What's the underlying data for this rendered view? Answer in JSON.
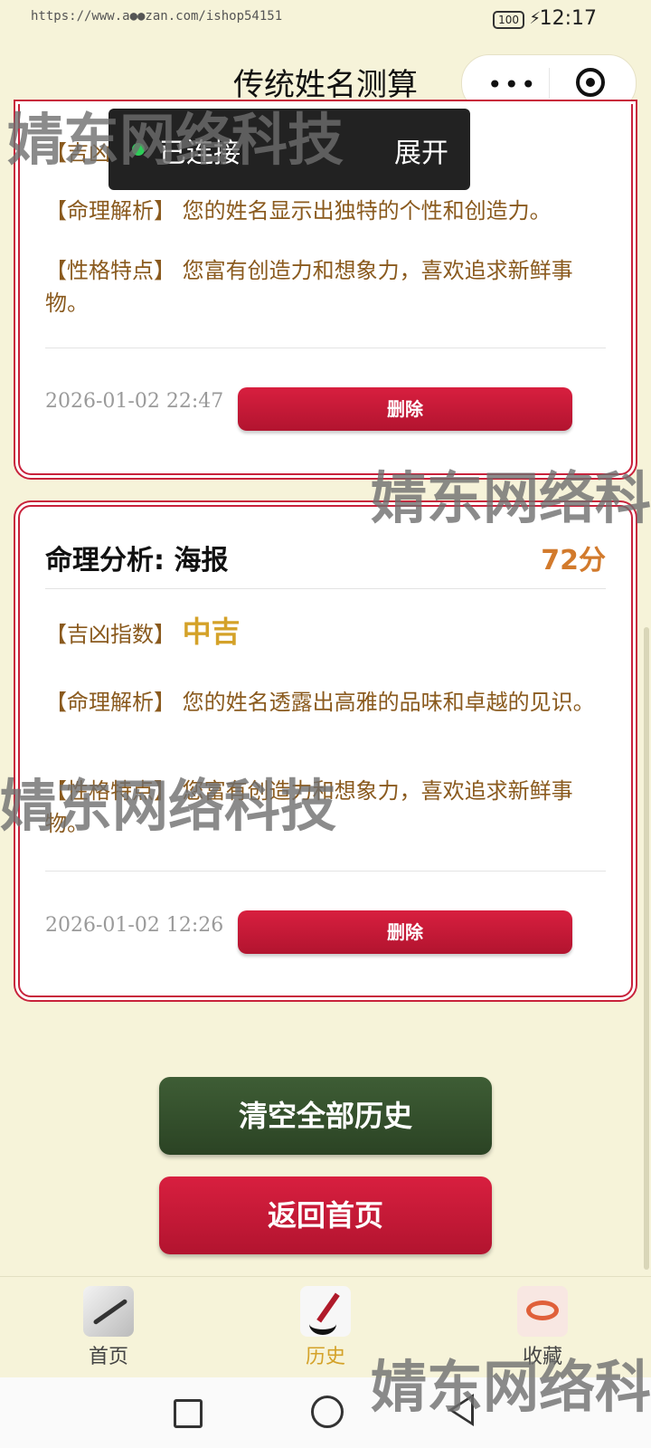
{
  "status_bar": {
    "url": "https://www.a●●zan.com/ishop54151",
    "battery": "100",
    "time": "12:17"
  },
  "header": {
    "title": "传统姓名测算",
    "more_icon": "•••"
  },
  "toast": {
    "status": "已连接",
    "expand": "展开"
  },
  "cards": [
    {
      "partial_label": "【吉凶指数】",
      "analysis_label": "【命理解析】",
      "analysis_text": "您的姓名显示出独特的个性和创造力。",
      "trait_label": "【性格特点】",
      "trait_text": "您富有创造力和想象力，喜欢追求新鲜事物。",
      "date": "2026-01-02 22:47",
      "delete": "删除"
    },
    {
      "title": "命理分析: 海报",
      "score": "72分",
      "luck_label": "【吉凶指数】",
      "luck_value": "中吉",
      "analysis_label": "【命理解析】",
      "analysis_text": "您的姓名透露出高雅的品味和卓越的见识。",
      "trait_label": "【性格特点】",
      "trait_text": "您富有创造力和想象力，喜欢追求新鲜事物。",
      "date": "2026-01-02 12:26",
      "delete": "删除"
    }
  ],
  "actions": {
    "clear": "清空全部历史",
    "home": "返回首页"
  },
  "tabs": [
    {
      "label": "首页",
      "icon": "brush-icon"
    },
    {
      "label": "历史",
      "icon": "ink-brush-icon"
    },
    {
      "label": "收藏",
      "icon": "cloud-icon"
    }
  ],
  "watermark": "婧东网络科技"
}
